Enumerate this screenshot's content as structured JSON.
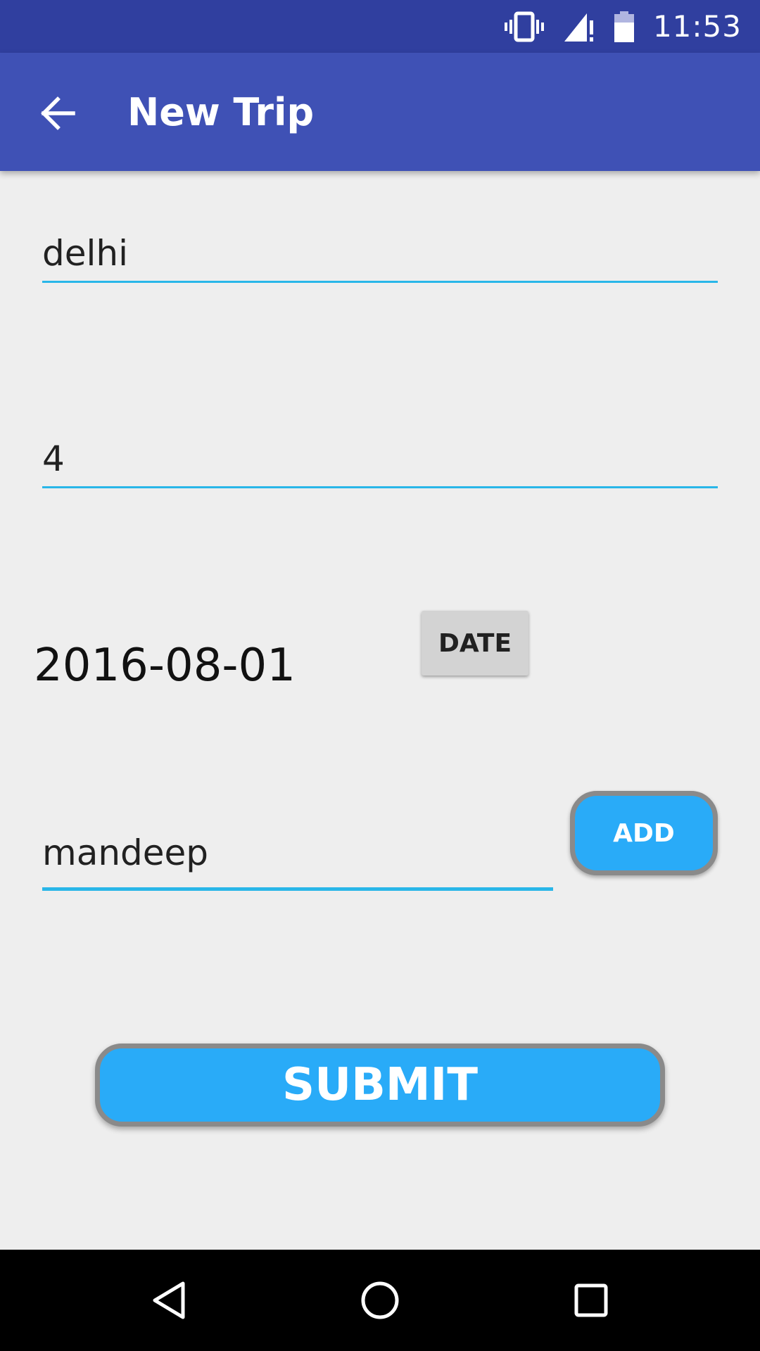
{
  "status_bar": {
    "time": "11:53",
    "icons": [
      "vibrate-icon",
      "signal-icon",
      "battery-icon"
    ]
  },
  "app_bar": {
    "title": "New Trip",
    "back_icon": "arrow-back-icon",
    "background": "#3F51B5",
    "status_background": "#303F9F"
  },
  "form": {
    "destination_value": "delhi",
    "days_value": "4",
    "date_value": "2016-08-01",
    "date_button_label": "DATE",
    "member_value": "mandeep",
    "add_button_label": "ADD",
    "submit_button_label": "SUBMIT",
    "accent_color": "#29B6E8",
    "button_color": "#29ABF8"
  },
  "nav_bar": {
    "icons": [
      "nav-back-icon",
      "nav-home-icon",
      "nav-recents-icon"
    ]
  }
}
